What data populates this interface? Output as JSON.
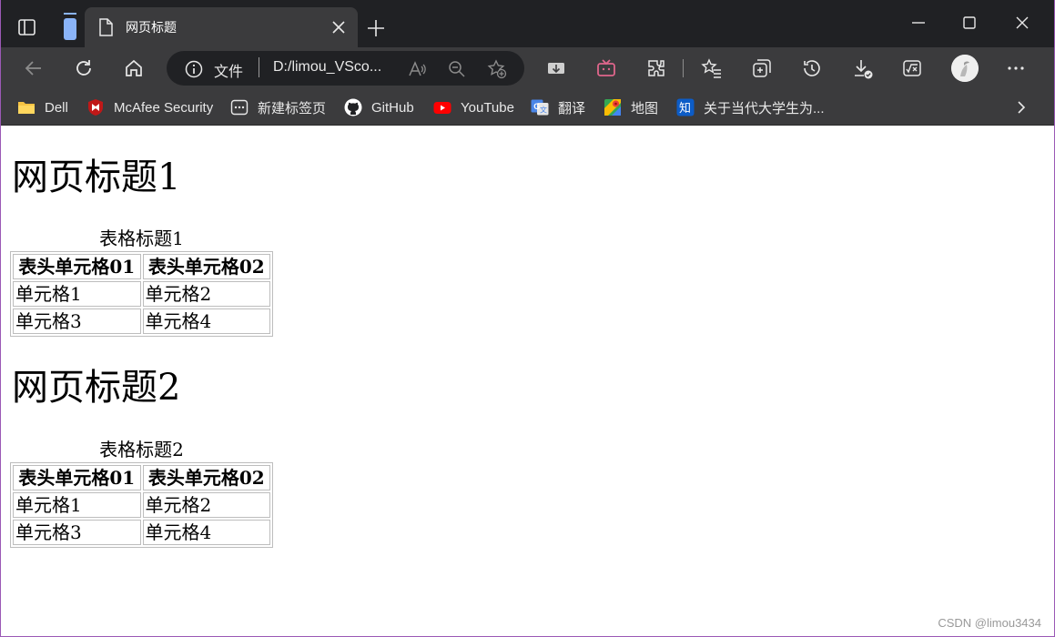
{
  "tab": {
    "title": "网页标题"
  },
  "address": {
    "scheme": "文件",
    "url": "D:/limou_VSco..."
  },
  "favorites": [
    {
      "label": "Dell",
      "icon": "folder-icon"
    },
    {
      "label": "McAfee Security",
      "icon": "mcafee-icon"
    },
    {
      "label": "新建标签页",
      "icon": "new-tab-page-icon"
    },
    {
      "label": "GitHub",
      "icon": "github-icon"
    },
    {
      "label": "YouTube",
      "icon": "youtube-icon"
    },
    {
      "label": "翻译",
      "icon": "translate-icon"
    },
    {
      "label": "地图",
      "icon": "maps-icon"
    },
    {
      "label": "关于当代大学生为...",
      "icon": "zhihu-icon"
    }
  ],
  "page": {
    "heading1": "网页标题1",
    "table1": {
      "caption": "表格标题1",
      "headers": [
        "表头单元格01",
        "表头单元格02"
      ],
      "rows": [
        [
          "单元格1",
          "单元格2"
        ],
        [
          "单元格3",
          "单元格4"
        ]
      ]
    },
    "heading2": "网页标题2",
    "table2": {
      "caption": "表格标题2",
      "headers": [
        "表头单元格01",
        "表头单元格02"
      ],
      "rows": [
        [
          "单元格1",
          "单元格2"
        ],
        [
          "单元格3",
          "单元格4"
        ]
      ]
    }
  },
  "watermark": "CSDN @limou3434",
  "colors": {
    "chrome_dark": "#202124",
    "chrome_toolbar": "#3b3b3d",
    "youtube_red": "#ff0000",
    "mcafee_red": "#c01818"
  }
}
